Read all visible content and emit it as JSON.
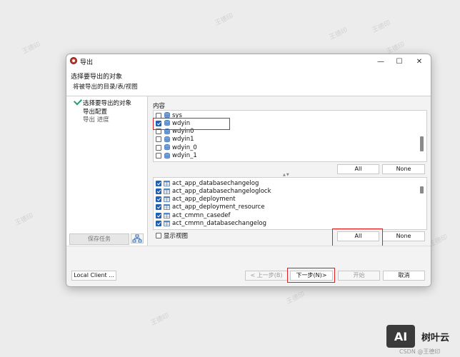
{
  "window": {
    "title": "导出",
    "minimize": "—",
    "maximize": "☐",
    "close": "✕"
  },
  "header": {
    "title": "选择要导出的对象",
    "subtitle": "将被导出的目录/表/视图"
  },
  "steps": [
    {
      "label": "选择要导出的对象",
      "done": true
    },
    {
      "label": "导出配置"
    },
    {
      "label": "导出 进度"
    }
  ],
  "left_panel": {
    "save_task": "保存任务",
    "tree_icon": "hierarchy-icon"
  },
  "content_label": "内容",
  "schemas": [
    {
      "name": "sys",
      "checked": false
    },
    {
      "name": "wdyin",
      "checked": true
    },
    {
      "name": "wdyin0",
      "checked": false
    },
    {
      "name": "wdyin1",
      "checked": false
    },
    {
      "name": "wdyin_0",
      "checked": false
    },
    {
      "name": "wdyin_1",
      "checked": false
    }
  ],
  "schema_buttons": {
    "all": "All",
    "none": "None"
  },
  "splitter": "▲▼",
  "tables": [
    {
      "name": "act_app_databasechangelog",
      "checked": true
    },
    {
      "name": "act_app_databasechangeloglock",
      "checked": true
    },
    {
      "name": "act_app_deployment",
      "checked": true
    },
    {
      "name": "act_app_deployment_resource",
      "checked": true
    },
    {
      "name": "act_cmmn_casedef",
      "checked": true
    },
    {
      "name": "act_cmmn_databasechangelog",
      "checked": true
    }
  ],
  "show_views": {
    "label": "显示视图",
    "checked": false
  },
  "table_buttons": {
    "all": "All",
    "none": "None"
  },
  "footer": {
    "local_client": "Local Client ...",
    "prev": "< 上一步(B)",
    "next": "下一步(N)>",
    "start": "开始",
    "cancel": "取消"
  },
  "watermark": "王德印",
  "corner": {
    "logo": "AI",
    "name": "树叶云",
    "sub": "CSDN @王德印"
  },
  "colors": {
    "accent": "#1f5fb5",
    "highlight": "#e02020",
    "done_check": "#2a9a7a"
  }
}
